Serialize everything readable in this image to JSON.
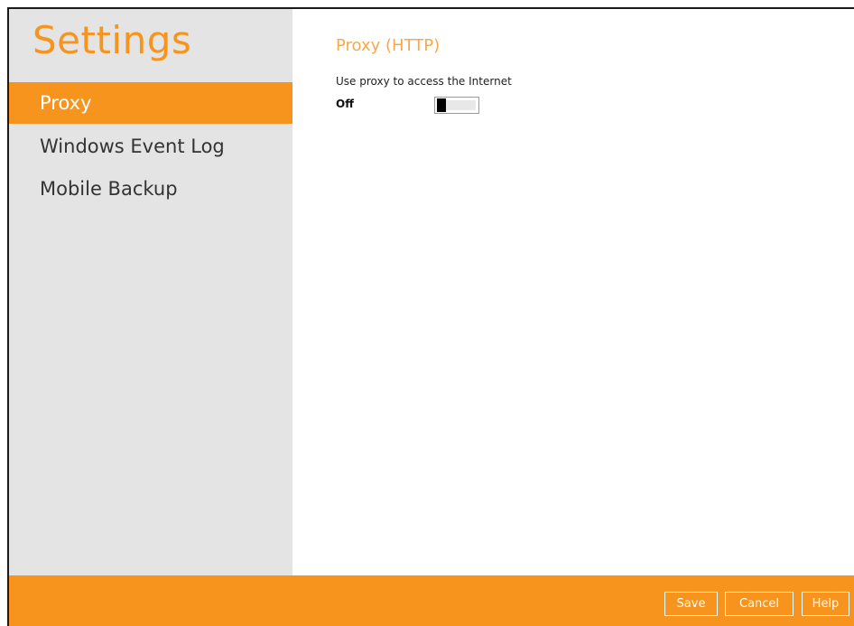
{
  "window": {
    "title": "Settings"
  },
  "sidebar": {
    "items": [
      {
        "label": "Proxy",
        "active": true
      },
      {
        "label": "Windows Event Log",
        "active": false
      },
      {
        "label": "Mobile Backup",
        "active": false
      }
    ]
  },
  "main": {
    "section_title": "Proxy (HTTP)",
    "proxy_label": "Use proxy to access the Internet",
    "proxy_state": "Off",
    "proxy_enabled": false
  },
  "footer": {
    "save_label": "Save",
    "cancel_label": "Cancel",
    "help_label": "Help"
  },
  "colors": {
    "accent": "#f7941d",
    "sidebar_bg": "#e4e4e4",
    "section_title": "#f7a94a"
  }
}
